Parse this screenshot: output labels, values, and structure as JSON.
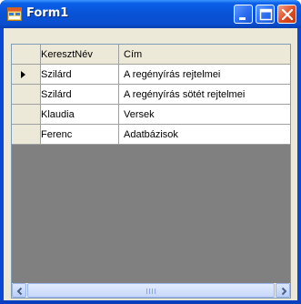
{
  "window": {
    "title": "Form1",
    "icon": "form-app-icon",
    "controls": [
      "minimize-icon",
      "maximize-icon",
      "close-icon"
    ]
  },
  "grid": {
    "columns": [
      "KeresztNév",
      "Cím"
    ],
    "rows": [
      {
        "keresztnev": "Szilárd",
        "cim": "A regényírás rejtelmei",
        "current": true
      },
      {
        "keresztnev": "Szilárd",
        "cim": "A regényírás sötét rejtelmei",
        "current": false
      },
      {
        "keresztnev": "Klaudia",
        "cim": "Versek",
        "current": false
      },
      {
        "keresztnev": "Ferenc",
        "cim": "Adatbázisok",
        "current": false
      }
    ],
    "current_row_indicator": "row-pointer-icon"
  },
  "colors": {
    "titlebar": "#0852d6",
    "client": "#ece9d8",
    "grid_background": "#808080",
    "close_button": "#e04b22"
  }
}
